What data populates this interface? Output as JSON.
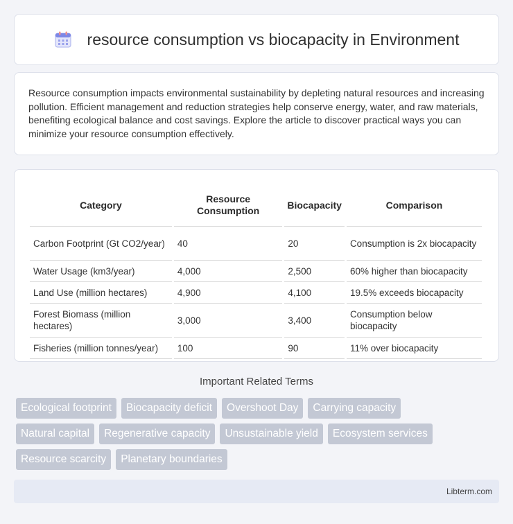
{
  "header": {
    "title": "resource consumption vs biocapacity in Environment",
    "icon": "calendar-icon"
  },
  "intro": {
    "text": "Resource consumption impacts environmental sustainability by depleting natural resources and increasing pollution. Efficient management and reduction strategies help conserve energy, water, and raw materials, benefiting ecological balance and cost savings. Explore the article to discover practical ways you can minimize your resource consumption effectively."
  },
  "table": {
    "headers": [
      "Category",
      "Resource Consumption",
      "Biocapacity",
      "Comparison"
    ],
    "rows": [
      [
        "Carbon Footprint (Gt CO2/year)",
        "40",
        "20",
        "Consumption is 2x biocapacity"
      ],
      [
        "Water Usage (km3/year)",
        "4,000",
        "2,500",
        "60% higher than biocapacity"
      ],
      [
        "Land Use (million hectares)",
        "4,900",
        "4,100",
        "19.5% exceeds biocapacity"
      ],
      [
        "Forest Biomass (million hectares)",
        "3,000",
        "3,400",
        "Consumption below biocapacity"
      ],
      [
        "Fisheries (million tonnes/year)",
        "100",
        "90",
        "11% over biocapacity"
      ]
    ]
  },
  "related": {
    "title": "Important Related Terms",
    "tags": [
      [
        "Ecological footprint",
        "Biocapacity deficit",
        "Overshoot Day",
        "Carrying capacity"
      ],
      [
        "Natural capital",
        "Regenerative capacity",
        "Unsustainable yield",
        "Ecosystem services"
      ],
      [
        "Resource scarcity",
        "Planetary boundaries"
      ]
    ]
  },
  "footer": {
    "text": "Libterm.com"
  },
  "colors": {
    "tag_bg": "#c3c8d4",
    "footer_bg": "#e6eaf4",
    "page_bg": "#f3f4f8"
  }
}
